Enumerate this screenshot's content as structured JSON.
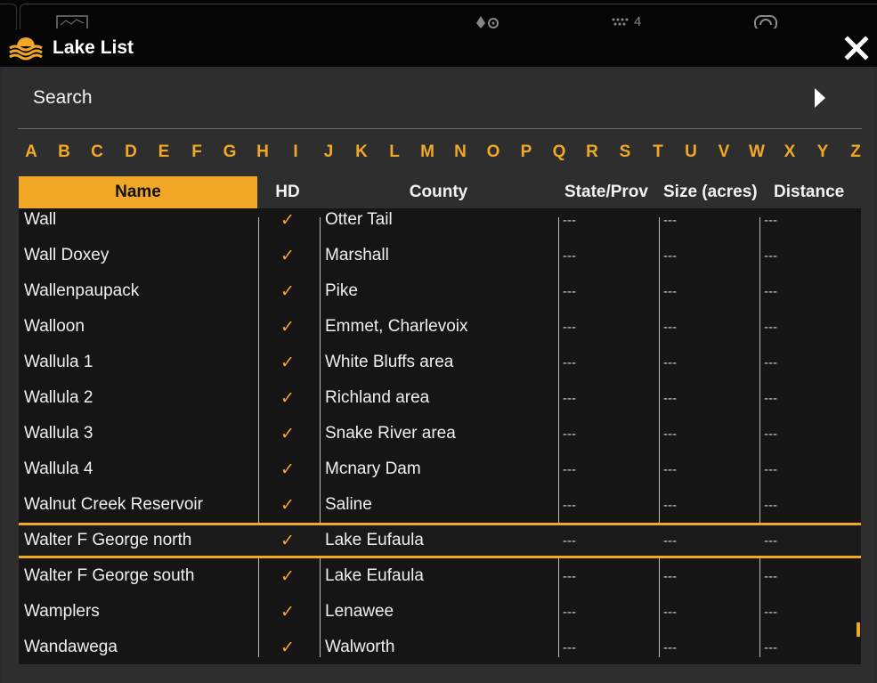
{
  "app": {
    "title": "Lake List",
    "close_label": "X",
    "top_tab_text": "4"
  },
  "search": {
    "label": "Search"
  },
  "alphabet": [
    "A",
    "B",
    "C",
    "D",
    "E",
    "F",
    "G",
    "H",
    "I",
    "J",
    "K",
    "L",
    "M",
    "N",
    "O",
    "P",
    "Q",
    "R",
    "S",
    "T",
    "U",
    "V",
    "W",
    "X",
    "Y",
    "Z"
  ],
  "columns": {
    "name": "Name",
    "hd": "HD",
    "county": "County",
    "state": "State/Prov",
    "size": "Size (acres)",
    "distance": "Distance"
  },
  "rows": [
    {
      "name": "Wall",
      "hd": "✓",
      "county": "Otter Tail",
      "state": "---",
      "size": "---",
      "distance": "---"
    },
    {
      "name": "Wall Doxey",
      "hd": "✓",
      "county": "Marshall",
      "state": "---",
      "size": "---",
      "distance": "---"
    },
    {
      "name": "Wallenpaupack",
      "hd": "✓",
      "county": "Pike",
      "state": "---",
      "size": "---",
      "distance": "---"
    },
    {
      "name": "Walloon",
      "hd": "✓",
      "county": "Emmet, Charlevoix",
      "state": "---",
      "size": "---",
      "distance": "---"
    },
    {
      "name": "Wallula 1",
      "hd": "✓",
      "county": "White Bluffs area",
      "state": "---",
      "size": "---",
      "distance": "---"
    },
    {
      "name": "Wallula 2",
      "hd": "✓",
      "county": "Richland area",
      "state": "---",
      "size": "---",
      "distance": "---"
    },
    {
      "name": "Wallula 3",
      "hd": "✓",
      "county": "Snake River area",
      "state": "---",
      "size": "---",
      "distance": "---"
    },
    {
      "name": "Wallula 4",
      "hd": "✓",
      "county": "Mcnary Dam",
      "state": "---",
      "size": "---",
      "distance": "---"
    },
    {
      "name": "Walnut Creek Reservoir",
      "hd": "✓",
      "county": "Saline",
      "state": "---",
      "size": "---",
      "distance": "---"
    },
    {
      "name": "Walter F George north",
      "hd": "✓",
      "county": "Lake Eufaula",
      "state": "---",
      "size": "---",
      "distance": "---"
    },
    {
      "name": "Walter F George south",
      "hd": "✓",
      "county": "Lake Eufaula",
      "state": "---",
      "size": "---",
      "distance": "---"
    },
    {
      "name": "Wamplers",
      "hd": "✓",
      "county": "Lenawee",
      "state": "---",
      "size": "---",
      "distance": "---"
    },
    {
      "name": "Wandawega",
      "hd": "✓",
      "county": "Walworth",
      "state": "---",
      "size": "---",
      "distance": "---"
    }
  ],
  "selected_row_index": 9,
  "colors": {
    "accent": "#f2a826",
    "background": "#2e2e2e",
    "titlebar": "#050505"
  },
  "icons": {
    "title": "lake-waves-icon",
    "close": "close-icon",
    "search_arrow": "arrow-right-icon"
  }
}
